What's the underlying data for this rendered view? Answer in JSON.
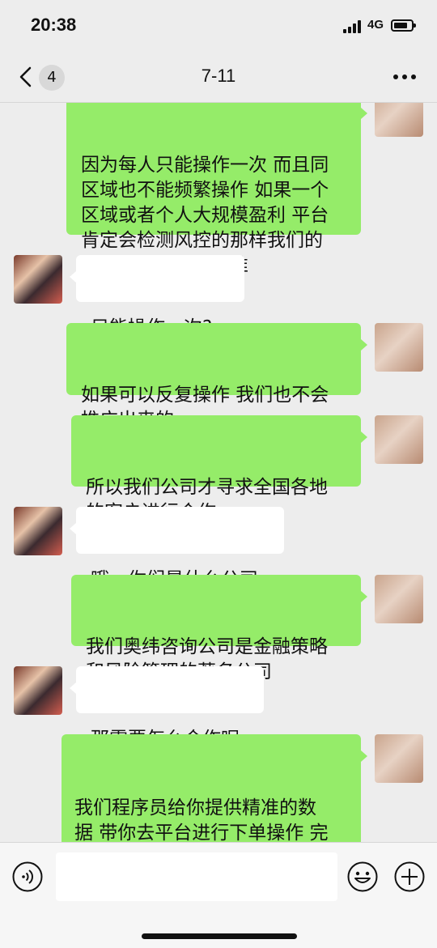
{
  "status_bar": {
    "time": "20:38",
    "network": "4G"
  },
  "nav": {
    "unread_count": "4",
    "title": "7-11"
  },
  "messages": [
    {
      "side": "sent",
      "text": "因为每人只能操作一次 而且同\n区域也不能频繁操作 如果一个\n区域或者个人大规模盈利 平台\n肯定会检测风控的那样我们的\n数据就会出现不精准"
    },
    {
      "side": "received",
      "text": "只能操作一次?"
    },
    {
      "side": "sent",
      "text": "如果可以反复操作 我们也不会\n推广出来的"
    },
    {
      "side": "sent",
      "text": "所以我们公司才寻求全国各地\n的客户进行合作"
    },
    {
      "side": "received",
      "text": "哦，你们是什么公司"
    },
    {
      "side": "sent",
      "text": "我们奥纬咨询公司是金融策略\n和风险管理的著名公司"
    },
    {
      "side": "received",
      "text": "那需要怎么合作呢"
    },
    {
      "side": "sent",
      "text": "我们程序员给你提供精准的数\n据 带你去平台进行下单操作 完\n成盈利后支付纯利润百分之二\n十作为技术费用"
    }
  ],
  "colors": {
    "sent_bubble": "#95ec69",
    "received_bubble": "#ffffff",
    "background": "#ededed"
  },
  "icons": {
    "back": "chevron-left-icon",
    "more": "more-icon",
    "voice": "voice-icon",
    "emoji": "emoji-icon",
    "plus": "plus-icon"
  }
}
